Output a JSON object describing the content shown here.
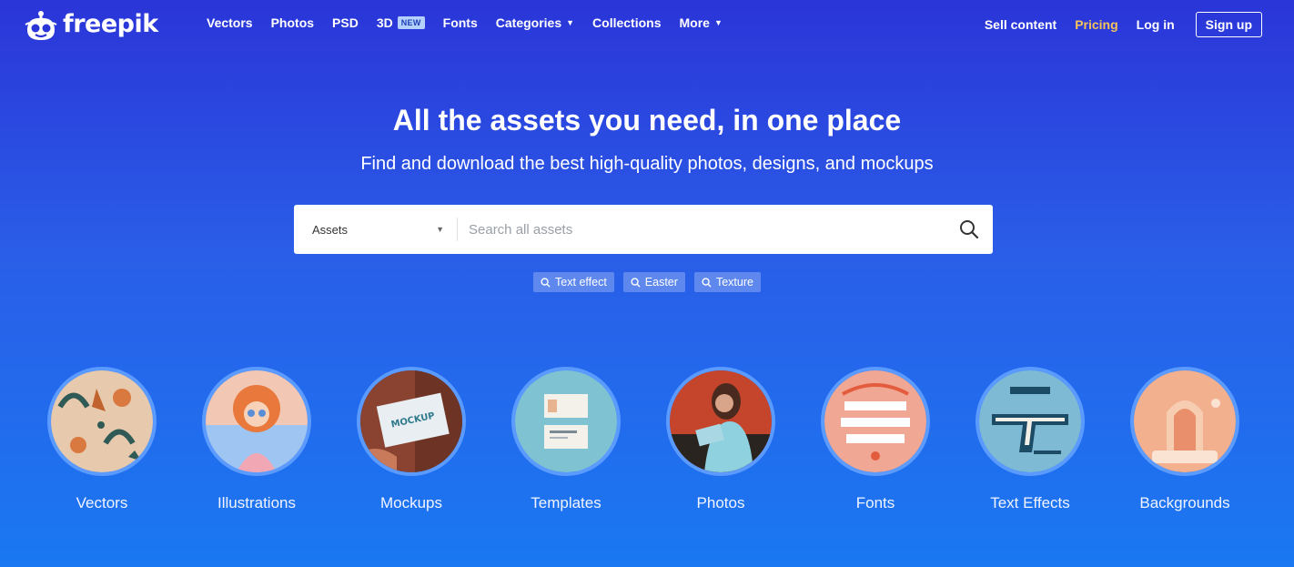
{
  "brand": {
    "name": "freepik"
  },
  "nav": {
    "items": [
      {
        "label": "Vectors"
      },
      {
        "label": "Photos"
      },
      {
        "label": "PSD"
      },
      {
        "label": "3D",
        "badge": "NEW"
      },
      {
        "label": "Fonts"
      },
      {
        "label": "Categories",
        "dropdown": true
      },
      {
        "label": "Collections"
      },
      {
        "label": "More",
        "dropdown": true
      }
    ],
    "sell": "Sell content",
    "pricing": "Pricing",
    "login": "Log in",
    "signup": "Sign up"
  },
  "hero": {
    "title": "All the assets you need, in one place",
    "subtitle": "Find and download the best high-quality photos, designs, and mockups"
  },
  "search": {
    "selected_type": "Assets",
    "placeholder": "Search all assets"
  },
  "suggestions": [
    {
      "label": "Text effect"
    },
    {
      "label": "Easter"
    },
    {
      "label": "Texture"
    }
  ],
  "categories": [
    {
      "label": "Vectors",
      "icon": "pattern-illustration"
    },
    {
      "label": "Illustrations",
      "icon": "woman-illustration"
    },
    {
      "label": "Mockups",
      "icon": "card-mockup"
    },
    {
      "label": "Templates",
      "icon": "business-card-template"
    },
    {
      "label": "Photos",
      "icon": "woman-reading-photo"
    },
    {
      "label": "Fonts",
      "icon": "lettering-poster"
    },
    {
      "label": "Text Effects",
      "icon": "type-text-effect"
    },
    {
      "label": "Backgrounds",
      "icon": "3d-arch-background"
    }
  ],
  "colors": {
    "bg_top": "#2b35d8",
    "bg_bottom": "#1a78f2",
    "pricing": "#f4c45a",
    "circle_border": "#5b9bff"
  }
}
